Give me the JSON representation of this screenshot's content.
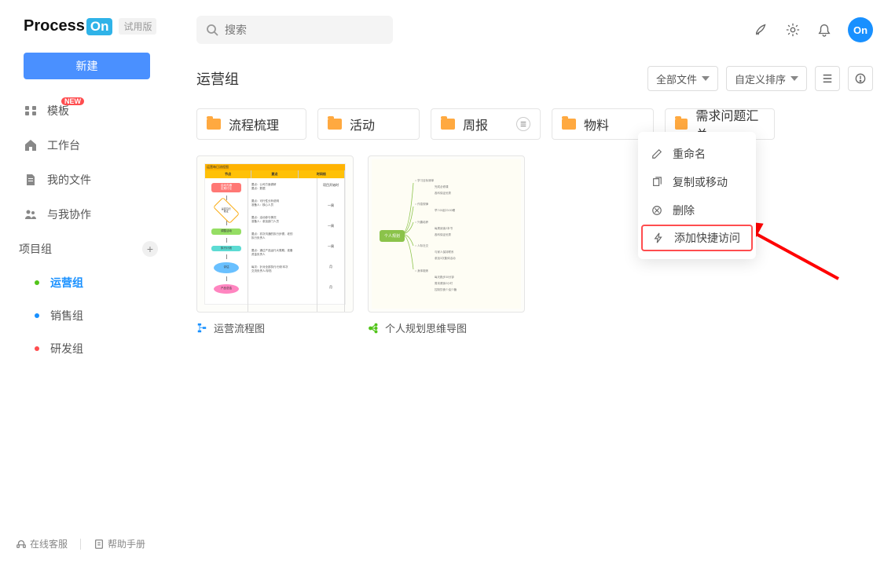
{
  "logo": {
    "text1": "Process",
    "text2": "On",
    "trial": "试用版"
  },
  "sidebar": {
    "new_btn": "新建",
    "nav": [
      {
        "label": "模板",
        "badge": "NEW"
      },
      {
        "label": "工作台"
      },
      {
        "label": "我的文件"
      },
      {
        "label": "与我协作"
      }
    ],
    "project_section": "项目组",
    "groups": [
      {
        "label": "运营组",
        "color": "green",
        "active": true
      },
      {
        "label": "销售组",
        "color": "blue"
      },
      {
        "label": "研发组",
        "color": "red"
      }
    ],
    "footer": {
      "support": "在线客服",
      "manual": "帮助手册"
    }
  },
  "search": {
    "placeholder": "搜索"
  },
  "avatar": "On",
  "page_title": "运营组",
  "filters": {
    "all_files": "全部文件",
    "sort": "自定义排序"
  },
  "folders": [
    {
      "name": "流程梳理"
    },
    {
      "name": "活动"
    },
    {
      "name": "周报",
      "has_context": true
    },
    {
      "name": "物料"
    },
    {
      "name": "需求问题汇总"
    }
  ],
  "files": [
    {
      "name": "运营流程图",
      "type": "flowchart"
    },
    {
      "name": "个人规划思维导图",
      "type": "mindmap"
    }
  ],
  "context_menu": {
    "rename": "重命名",
    "copy_move": "复制或移动",
    "delete": "删除",
    "add_quick": "添加快捷访问"
  },
  "flowchart_content": {
    "title": "运营每日流程图",
    "headers": [
      "节点",
      "要点",
      "时间线"
    ]
  },
  "mindmap_content": {
    "root": "个人规划"
  }
}
